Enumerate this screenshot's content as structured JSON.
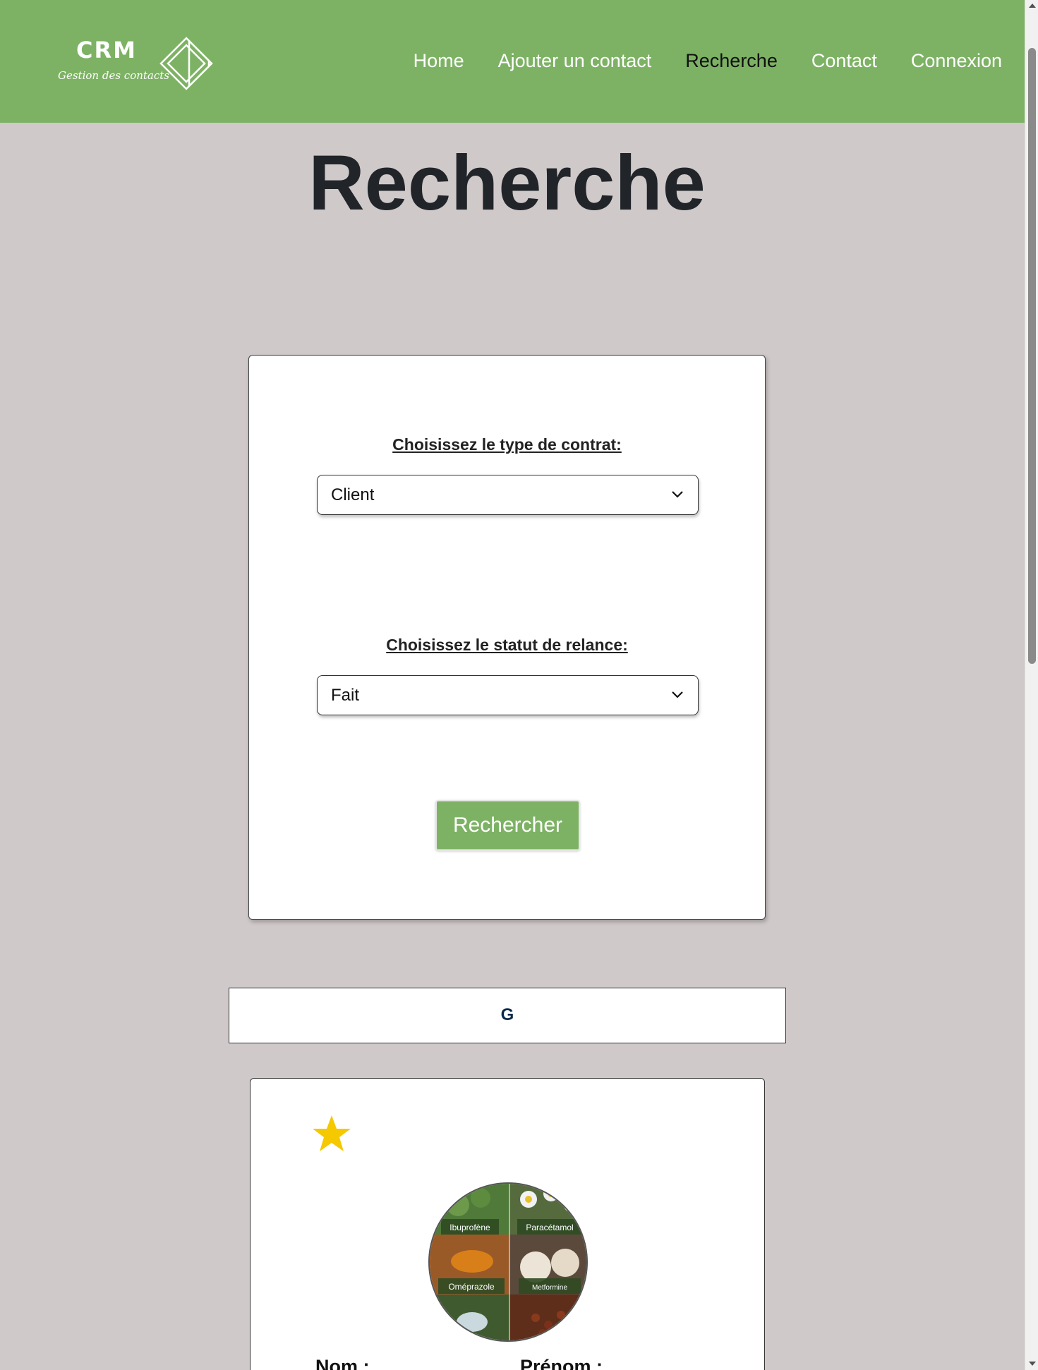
{
  "header": {
    "logo_title": "CRM",
    "logo_tagline": "Gestion des contacts",
    "nav": [
      {
        "label": "Home"
      },
      {
        "label": "Ajouter un contact"
      },
      {
        "label": "Recherche"
      },
      {
        "label": "Contact"
      },
      {
        "label": "Connexion"
      }
    ],
    "active_nav": "Recherche"
  },
  "page": {
    "title": "Recherche"
  },
  "search_form": {
    "contract_label": "Choisissez le type de contrat:",
    "contract_value": "Client",
    "status_label": "Choisissez le statut de relance:",
    "status_value": "Fait",
    "submit_label": "Rechercher"
  },
  "results": {
    "letter": "G",
    "card": {
      "favorite_icon": "star-icon",
      "image_labels": [
        "Ibuprofène",
        "Paracétamol",
        "Oméprazole",
        "Metformine"
      ],
      "nom_label": "Nom :",
      "prenom_label": "Prénom :"
    }
  },
  "colors": {
    "brand_green": "#7db264",
    "page_bg": "#d0c9c9",
    "star": "#f5c800"
  }
}
